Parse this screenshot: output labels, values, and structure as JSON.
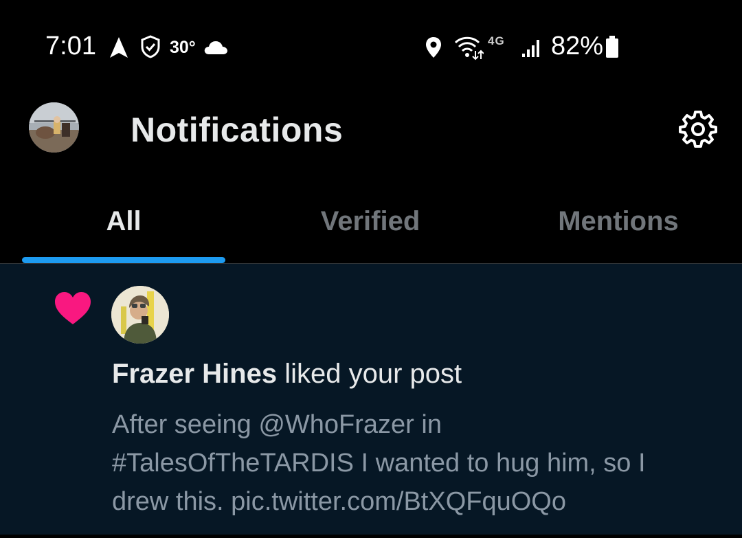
{
  "status_bar": {
    "time": "7:01",
    "temperature": "30°",
    "network": "4G",
    "battery": "82%",
    "icons": [
      "navigation-arrow-icon",
      "shield-check-icon",
      "cloud-icon",
      "location-pin-icon",
      "wifi-calling-icon",
      "signal-bars-icon",
      "battery-icon"
    ]
  },
  "header": {
    "title": "Notifications",
    "settings_icon": "gear-icon"
  },
  "tabs": [
    {
      "label": "All",
      "active": true
    },
    {
      "label": "Verified",
      "active": false
    },
    {
      "label": "Mentions",
      "active": false
    }
  ],
  "colors": {
    "accent": "#1d9bf0",
    "like": "#f91880",
    "notification_bg": "#061725"
  },
  "notifications": [
    {
      "type": "like",
      "icon": "heart-icon",
      "user_name": "Frazer Hines",
      "action": " liked your post",
      "post_lines": [
        "After seeing @WhoFrazer in",
        "#TalesOfTheTARDIS I wanted to hug him, so I",
        "drew this. pic.twitter.com/BtXQFquOQo"
      ]
    }
  ]
}
